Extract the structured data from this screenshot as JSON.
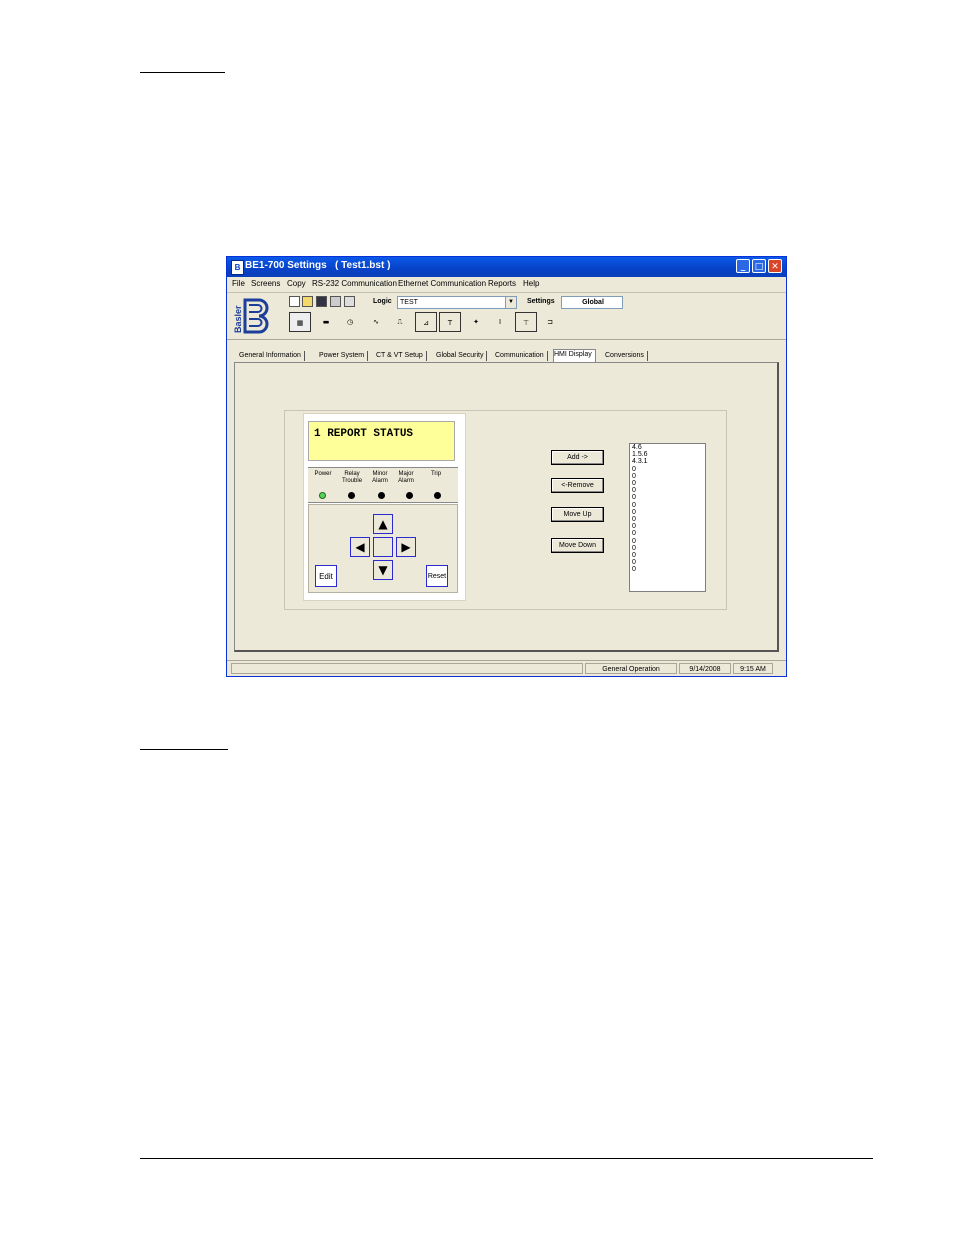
{
  "window": {
    "title": "BE1-700 Settings   ( Test1.bst )",
    "app_icon_name": "app-icon",
    "controls": {
      "minimize": "_",
      "maximize": "□",
      "close": "✕"
    }
  },
  "menu": [
    "File",
    "Screens",
    "Copy",
    "RS-232 Communication",
    "Ethernet Communication",
    "Reports",
    "Help"
  ],
  "toolbar": {
    "logo_text": "Basler",
    "logic_label": "Logic",
    "logic_value": "TEST",
    "settings_label": "Settings",
    "settings_value": "Global"
  },
  "tabs": [
    "General Information",
    "Power System",
    "CT & VT Setup",
    "Global Security",
    "Communication",
    "HMI Display",
    "Conversions"
  ],
  "selected_tab": "HMI Display",
  "hmi": {
    "lcd_text": "1 REPORT STATUS",
    "leds": [
      {
        "label": "Power",
        "state": "on"
      },
      {
        "label": "Relay Trouble",
        "state": "off"
      },
      {
        "label": "Minor Alarm",
        "state": "off"
      },
      {
        "label": "Major Alarm",
        "state": "off"
      },
      {
        "label": "Trip",
        "state": "off"
      }
    ],
    "edit_label": "Edit",
    "reset_label": "Reset"
  },
  "buttons": {
    "add": "Add ->",
    "remove": "<-Remove",
    "move_up": "Move Up",
    "move_down": "Move Down"
  },
  "list_items": [
    "4.6",
    "1.5.6",
    "4.3.1",
    "0",
    "0",
    "0",
    "0",
    "0",
    "0",
    "0",
    "0",
    "0",
    "0",
    "0",
    "0",
    "0",
    "0",
    "0"
  ],
  "status": {
    "mode": "General Operation",
    "date": "9/14/2008",
    "time": "9:15 AM"
  }
}
